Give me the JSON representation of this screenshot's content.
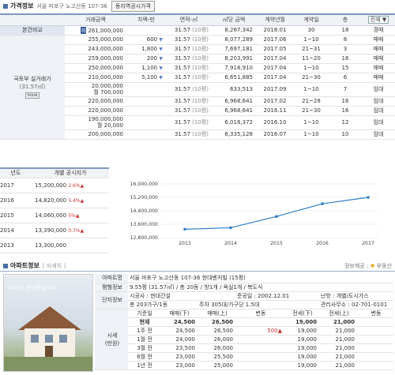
{
  "price": {
    "title": "가격정보",
    "address": "서울 마포구 노고산동 107-36",
    "button": "동지역공시가격",
    "headers": [
      "거래금액",
      "차액-만",
      "면적-㎡",
      "㎡당 금액",
      "계약년월",
      "계약일",
      "층"
    ],
    "type_filter": "전체",
    "label_top": "본건비교",
    "label_mid": "국토부 실거래가",
    "label_sub": "(31.57㎡)",
    "label_more": "more",
    "rows": [
      {
        "price": "261,000,000",
        "diff": "",
        "area": "31.57",
        "unit": "(10평)",
        "per": "8,267,342",
        "ym": "2018.01",
        "day": "30",
        "floor": "18",
        "type": "경매",
        "badge": "지"
      },
      {
        "price": "255,000,000",
        "diff": "600",
        "area": "31.57",
        "unit": "(10평)",
        "per": "8,077,289",
        "ym": "2017.06",
        "day": "1~10",
        "floor": "8",
        "type": "매매"
      },
      {
        "price": "243,000,000",
        "diff": "1,800",
        "area": "31.57",
        "unit": "(10평)",
        "per": "7,697,181",
        "ym": "2017.05",
        "day": "21~31",
        "floor": "3",
        "type": "매매"
      },
      {
        "price": "259,000,000",
        "diff": "200",
        "area": "31.57",
        "unit": "(10평)",
        "per": "8,203,991",
        "ym": "2017.04",
        "day": "11~20",
        "floor": "16",
        "type": "매매"
      },
      {
        "price": "250,000,000",
        "diff": "1,100",
        "area": "31.57",
        "unit": "(10평)",
        "per": "7,918,910",
        "ym": "2017.04",
        "day": "1~10",
        "floor": "15",
        "type": "매매"
      },
      {
        "price": "210,000,000",
        "diff": "5,100",
        "area": "31.57",
        "unit": "(10평)",
        "per": "6,651,885",
        "ym": "2017.04",
        "day": "21~30",
        "floor": "6",
        "type": "매매"
      },
      {
        "price": "20,000,000",
        "price2": "월 700,000",
        "diff": "",
        "area": "31.57",
        "unit": "(10평)",
        "per": "633,513",
        "ym": "2017.09",
        "day": "1~10",
        "floor": "7",
        "type": "임대"
      },
      {
        "price": "220,000,000",
        "diff": "",
        "area": "31.57",
        "unit": "(10평)",
        "per": "6,968,641",
        "ym": "2017.02",
        "day": "21~28",
        "floor": "16",
        "type": "임대"
      },
      {
        "price": "220,000,000",
        "diff": "",
        "area": "31.57",
        "unit": "(10평)",
        "per": "6,968,641",
        "ym": "2016.11",
        "day": "21~30",
        "floor": "16",
        "type": "임대"
      },
      {
        "price": "190,000,000",
        "price2": "월 20,000",
        "diff": "",
        "area": "31.57",
        "unit": "(10평)",
        "per": "6,018,372",
        "ym": "2016.10",
        "day": "1~10",
        "floor": "12",
        "type": "임대"
      },
      {
        "price": "200,000,000",
        "diff": "",
        "area": "31.57",
        "unit": "(10평)",
        "per": "6,335,128",
        "ym": "2016.07",
        "day": "1~10",
        "floor": "10",
        "type": "임대"
      }
    ]
  },
  "gongsi": {
    "headers": [
      "년도",
      "개별 공시지가"
    ],
    "rows": [
      {
        "year": "2017",
        "value": "15,200,000",
        "pct": "2.6%"
      },
      {
        "year": "2016",
        "value": "14,820,000",
        "pct": "5.4%"
      },
      {
        "year": "2015",
        "value": "14,060,000",
        "pct": "5%"
      },
      {
        "year": "2014",
        "value": "13,390,000",
        "pct": "0.7%"
      },
      {
        "year": "2013",
        "value": "13,300,000",
        "pct": ""
      }
    ]
  },
  "chart_data": {
    "type": "line",
    "x": [
      "2013",
      "2014",
      "2015",
      "2016",
      "2017"
    ],
    "series": [
      {
        "values": [
          13300000,
          13390000,
          14060000,
          14820000,
          15200000
        ]
      }
    ],
    "ylim": [
      12800000,
      16000000
    ],
    "yticks": [
      "16,000,000",
      "15,200,000",
      "14,400,000",
      "13,600,000",
      "12,800,000"
    ],
    "line_color": "#2f7fc8"
  },
  "apt": {
    "title": "아파트정보",
    "more": "[ 자세히 ]",
    "source_label": "정보제공 :",
    "source_name": "부동산",
    "photo_caption": "이미지 준비중입니다.",
    "rows": {
      "name_label": "아파트명",
      "name": "서울 마포구 노고산동 107-36 현대벤처빌 (15평)",
      "area_label": "평형정보",
      "area": "9.55평 (31.57㎡) / 총 20동 / 방1개 / 욕실1개 / 복도식",
      "complex_label": "단지정보",
      "builder_label": "시공사 : 현대건설",
      "done_label": "준공일 : 2002.12.01",
      "heat_label": "난방 : 개별/도시가스",
      "count": "총 203가구/1동",
      "parking": "주차 305대/가구당 1.5대",
      "office": "관리사무소 : 02-701-0101"
    },
    "market_label": "시세",
    "market_unit": "(만원)",
    "market_headers": [
      "기준일",
      "매매(下)",
      "매매(上)",
      "변동",
      "전세(下)",
      "전세(上)",
      "변동"
    ],
    "market_rows": [
      {
        "date": "현재",
        "s1": "24,500",
        "s2": "26,500",
        "c1": "",
        "j1": "19,000",
        "j2": "21,000",
        "c2": ""
      },
      {
        "date": "1주 전",
        "s1": "24,500",
        "s2": "26,500",
        "c1": "500▲",
        "j1": "19,000",
        "j2": "21,000",
        "c2": ""
      },
      {
        "date": "1월 전",
        "s1": "24,000",
        "s2": "26,000",
        "c1": "",
        "j1": "19,000",
        "j2": "21,000",
        "c2": ""
      },
      {
        "date": "3월 전",
        "s1": "23,500",
        "s2": "26,000",
        "c1": "",
        "j1": "19,000",
        "j2": "21,000",
        "c2": ""
      },
      {
        "date": "6월 전",
        "s1": "23,000",
        "s2": "25,500",
        "c1": "",
        "j1": "19,000",
        "j2": "21,000",
        "c2": ""
      },
      {
        "date": "1년 전",
        "s1": "23,000",
        "s2": "25,000",
        "c1": "",
        "j1": "19,000",
        "j2": "21,000",
        "c2": ""
      }
    ]
  }
}
